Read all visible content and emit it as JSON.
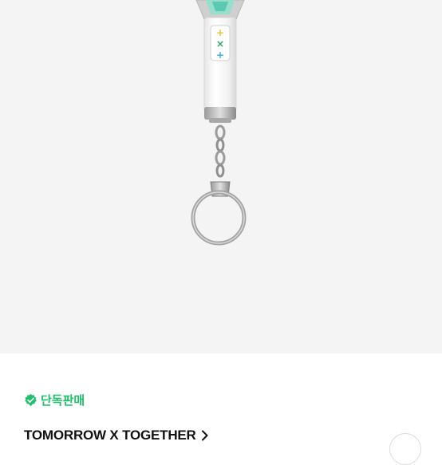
{
  "product": {
    "image_alt": "TXT lightstick keyring",
    "logo_glyphs": [
      "+",
      "×",
      "+"
    ]
  },
  "badge": {
    "label": "단독판매",
    "icon": "verified-check-icon",
    "color": "#1fbf6b"
  },
  "artist": {
    "name": "TOMORROW X TOGETHER",
    "icon": "chevron-right-icon"
  },
  "share": {
    "icon": "share-icon"
  }
}
